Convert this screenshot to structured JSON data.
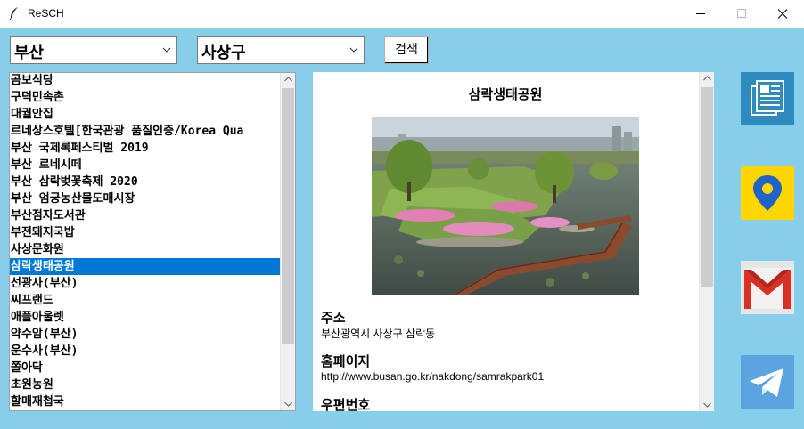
{
  "window": {
    "title": "ReSCH",
    "minimize_icon": "minimize-icon",
    "maximize_icon": "maximize-icon",
    "close_icon": "close-icon"
  },
  "controls": {
    "region_select": {
      "value": "부산"
    },
    "district_select": {
      "value": "사상구"
    },
    "search_button": "검색"
  },
  "places": {
    "items": [
      "곰보식당",
      "구덕민속촌",
      "대궐안집",
      "르네상스호텔[한국관광 품질인증/Korea Qua",
      "부산 국제록페스티벌 2019",
      "부산 르네시떼",
      "부산 삼락벚꽃축제 2020",
      "부산 엄궁농산물도매시장",
      "부산점자도서관",
      "부전돼지국밥",
      "사상문화원",
      "삼락생태공원",
      "선광사(부산)",
      "씨프랜드",
      "애플아울렛",
      "약수암(부산)",
      "운수사(부산)",
      "쫄아닥",
      "초원농원",
      "할매재첩국"
    ],
    "selected_index": 11
  },
  "detail": {
    "title": "삼락생태공원",
    "photo": "park-photo",
    "address_label": "주소",
    "address": "부산광역시 사상구 삼락동",
    "homepage_label": "홈페이지",
    "homepage": "http://www.busan.go.kr/nakdong/samrakpark01",
    "zipcode_label": "우편번호"
  },
  "sidebar": [
    {
      "icon": "document-icon",
      "color": "#2E8BC0"
    },
    {
      "icon": "map-pin-icon",
      "color": "#FFD700"
    },
    {
      "icon": "gmail-icon",
      "color": "#EA4335"
    },
    {
      "icon": "telegram-icon",
      "color": "#5BA4E0"
    }
  ],
  "colors": {
    "background": "#87CEEB",
    "selection": "#0078D7"
  }
}
